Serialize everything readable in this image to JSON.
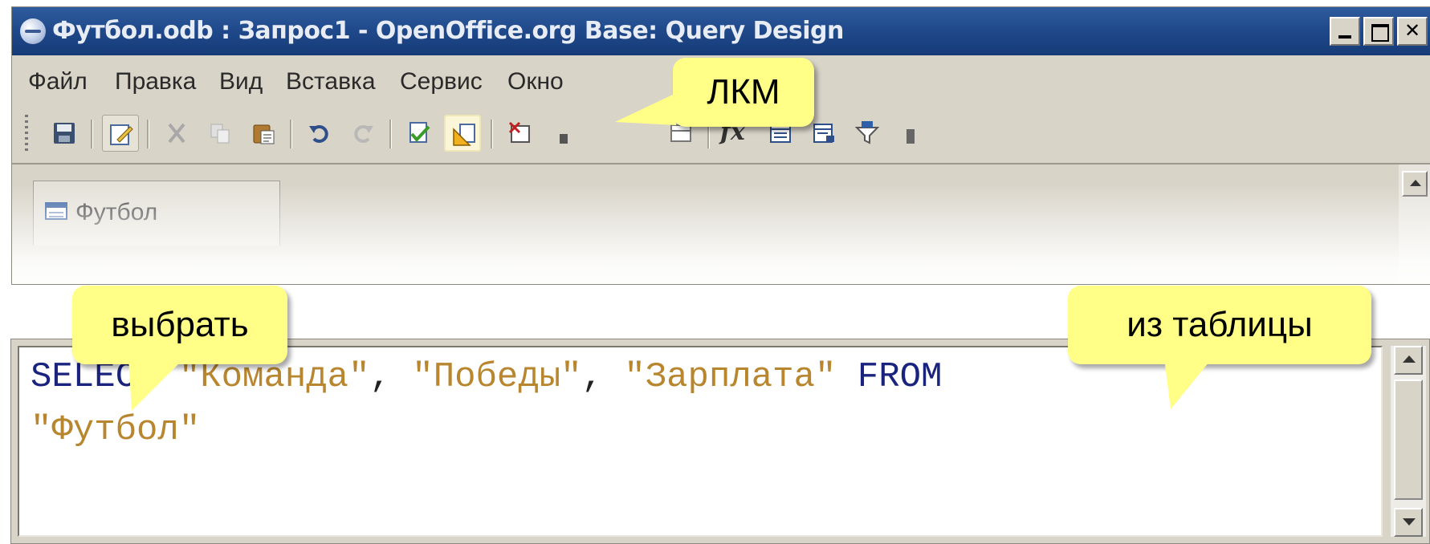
{
  "window": {
    "title": "Футбол.odb : Запрос1 - OpenOffice.org Base: Query Design"
  },
  "menu": [
    "Файл",
    "Правка",
    "Вид",
    "Вставка",
    "Сервис",
    "Окно"
  ],
  "toolbar": {
    "icons": [
      "save-icon",
      "edit-mode-icon",
      "cut-icon",
      "copy-icon",
      "paste-icon",
      "undo-icon",
      "redo-icon",
      "run-query-icon",
      "design-view-icon",
      "add-table-icon",
      "functions-icon",
      "table-name-icon",
      "alias-icon",
      "distinct-values-icon"
    ],
    "functions_label": "fx"
  },
  "tables_panel": {
    "table_name": "Футбол"
  },
  "sql": {
    "line1": [
      {
        "t": "SELECT",
        "k": "keyword"
      },
      {
        "t": " ",
        "k": "space"
      },
      {
        "t": "\"Команда\"",
        "k": "string"
      },
      {
        "t": ", ",
        "k": "punct"
      },
      {
        "t": "\"Победы\"",
        "k": "string"
      },
      {
        "t": ", ",
        "k": "punct"
      },
      {
        "t": "\"Зарплата\"",
        "k": "string"
      },
      {
        "t": " ",
        "k": "space"
      },
      {
        "t": "FROM",
        "k": "keyword"
      }
    ],
    "line2": "\"Футбол\""
  },
  "callouts": {
    "lkm": "ЛКМ",
    "select": "выбрать",
    "from_table": "из таблицы"
  },
  "colors": {
    "title_bar": "#204a8c",
    "sql_keyword": "#1a237e",
    "sql_string": "#b8862e",
    "callout": "#ffff88"
  }
}
